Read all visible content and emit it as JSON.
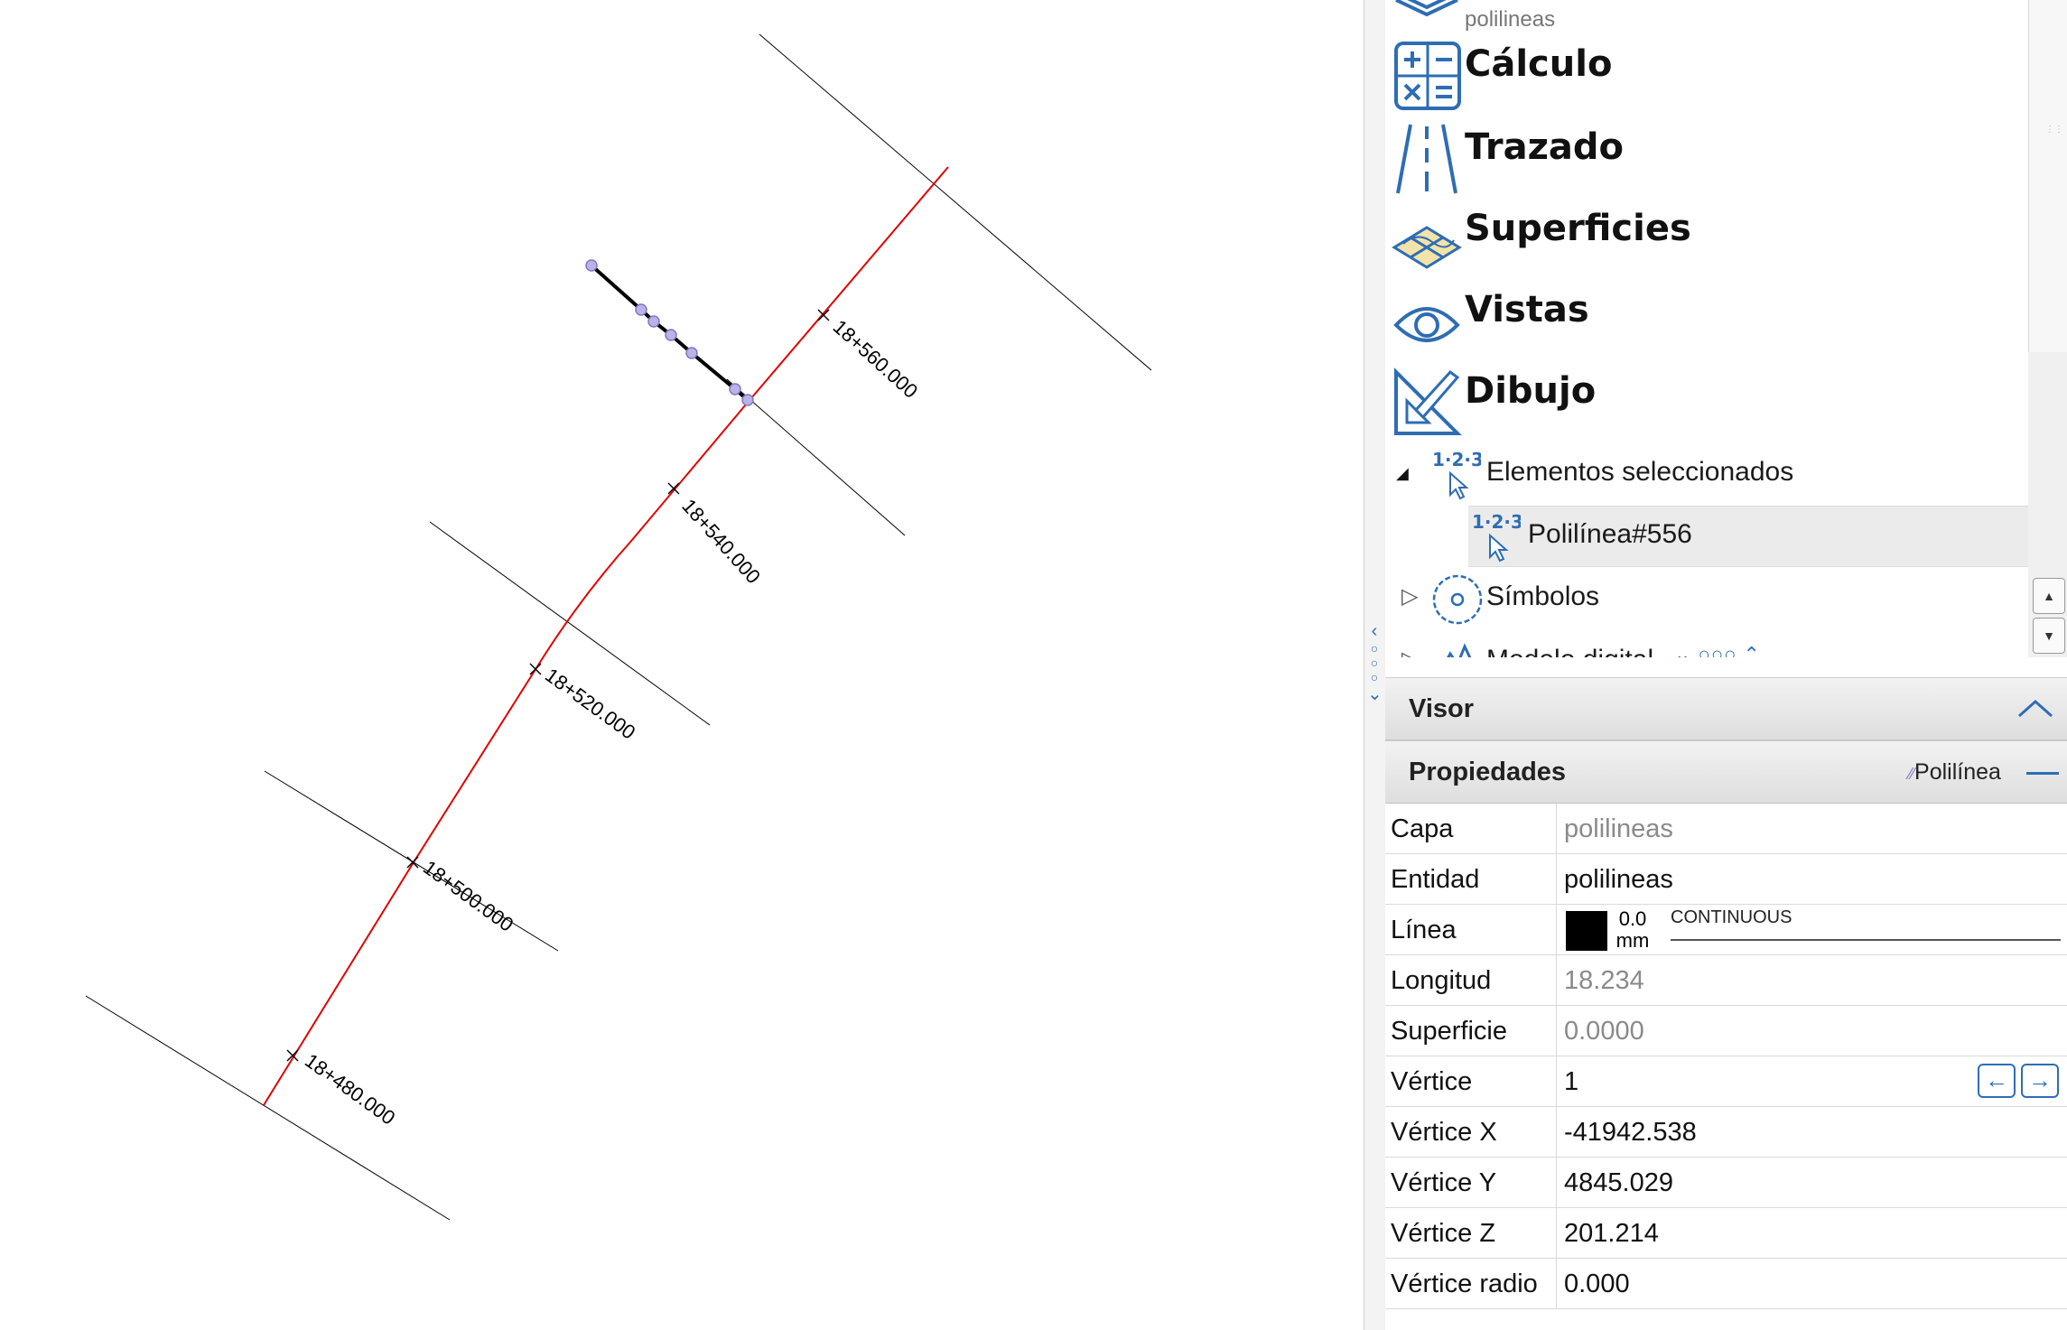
{
  "tree": {
    "partial_item_sub": "polilineas",
    "big_items": [
      {
        "label": "Cálculo",
        "icon": "calculator-icon"
      },
      {
        "label": "Trazado",
        "icon": "road-alignment-icon"
      },
      {
        "label": "Superficies",
        "icon": "surfaces-icon"
      },
      {
        "label": "Vistas",
        "icon": "eye-icon"
      },
      {
        "label": "Dibujo",
        "icon": "set-square-pencil-icon"
      }
    ],
    "selected_group": {
      "label": "Elementos seleccionados",
      "icon": "numbered-cursor-icon",
      "expanded": true
    },
    "selected_child": {
      "label": "Polilínea#556",
      "icon": "numbered-cursor-icon"
    },
    "symbols": {
      "label": "Símbolos",
      "icon": "symbols-icon",
      "expanded": false
    },
    "partially_visible": {
      "label": "Modelo digital",
      "icon": "terrain-icon"
    }
  },
  "panel": {
    "visor_title": "Visor",
    "properties_title": "Propiedades",
    "entity_type": "Polilínea"
  },
  "properties": [
    {
      "name": "Capa",
      "value": "polilineas",
      "readonly": true
    },
    {
      "name": "Entidad",
      "value": "polilineas",
      "readonly": false
    },
    {
      "name": "Línea",
      "value": "",
      "readonly": false,
      "line": {
        "width": "0.0",
        "unit": "mm",
        "type": "CONTINUOUS",
        "color": "#000000"
      }
    },
    {
      "name": "Longitud",
      "value": "18.234",
      "readonly": true
    },
    {
      "name": "Superficie",
      "value": "0.0000",
      "readonly": true
    },
    {
      "name": "Vértice",
      "value": "1",
      "readonly": false,
      "has_nav": true
    },
    {
      "name": "Vértice X",
      "value": "-41942.538",
      "readonly": false
    },
    {
      "name": "Vértice Y",
      "value": "4845.029",
      "readonly": false
    },
    {
      "name": "Vértice Z",
      "value": "201.214",
      "readonly": false
    },
    {
      "name": "Vértice radio",
      "value": "0.000",
      "readonly": false
    }
  ],
  "drawing": {
    "stations": [
      "18+480.000",
      "18+500.000",
      "18+520.000",
      "18+540.000",
      "18+560.000"
    ],
    "axis_color": "#e00000",
    "cross_section_color": "#000000",
    "polyline_color": "#000000",
    "vertex_color": "#b9b4e6"
  }
}
